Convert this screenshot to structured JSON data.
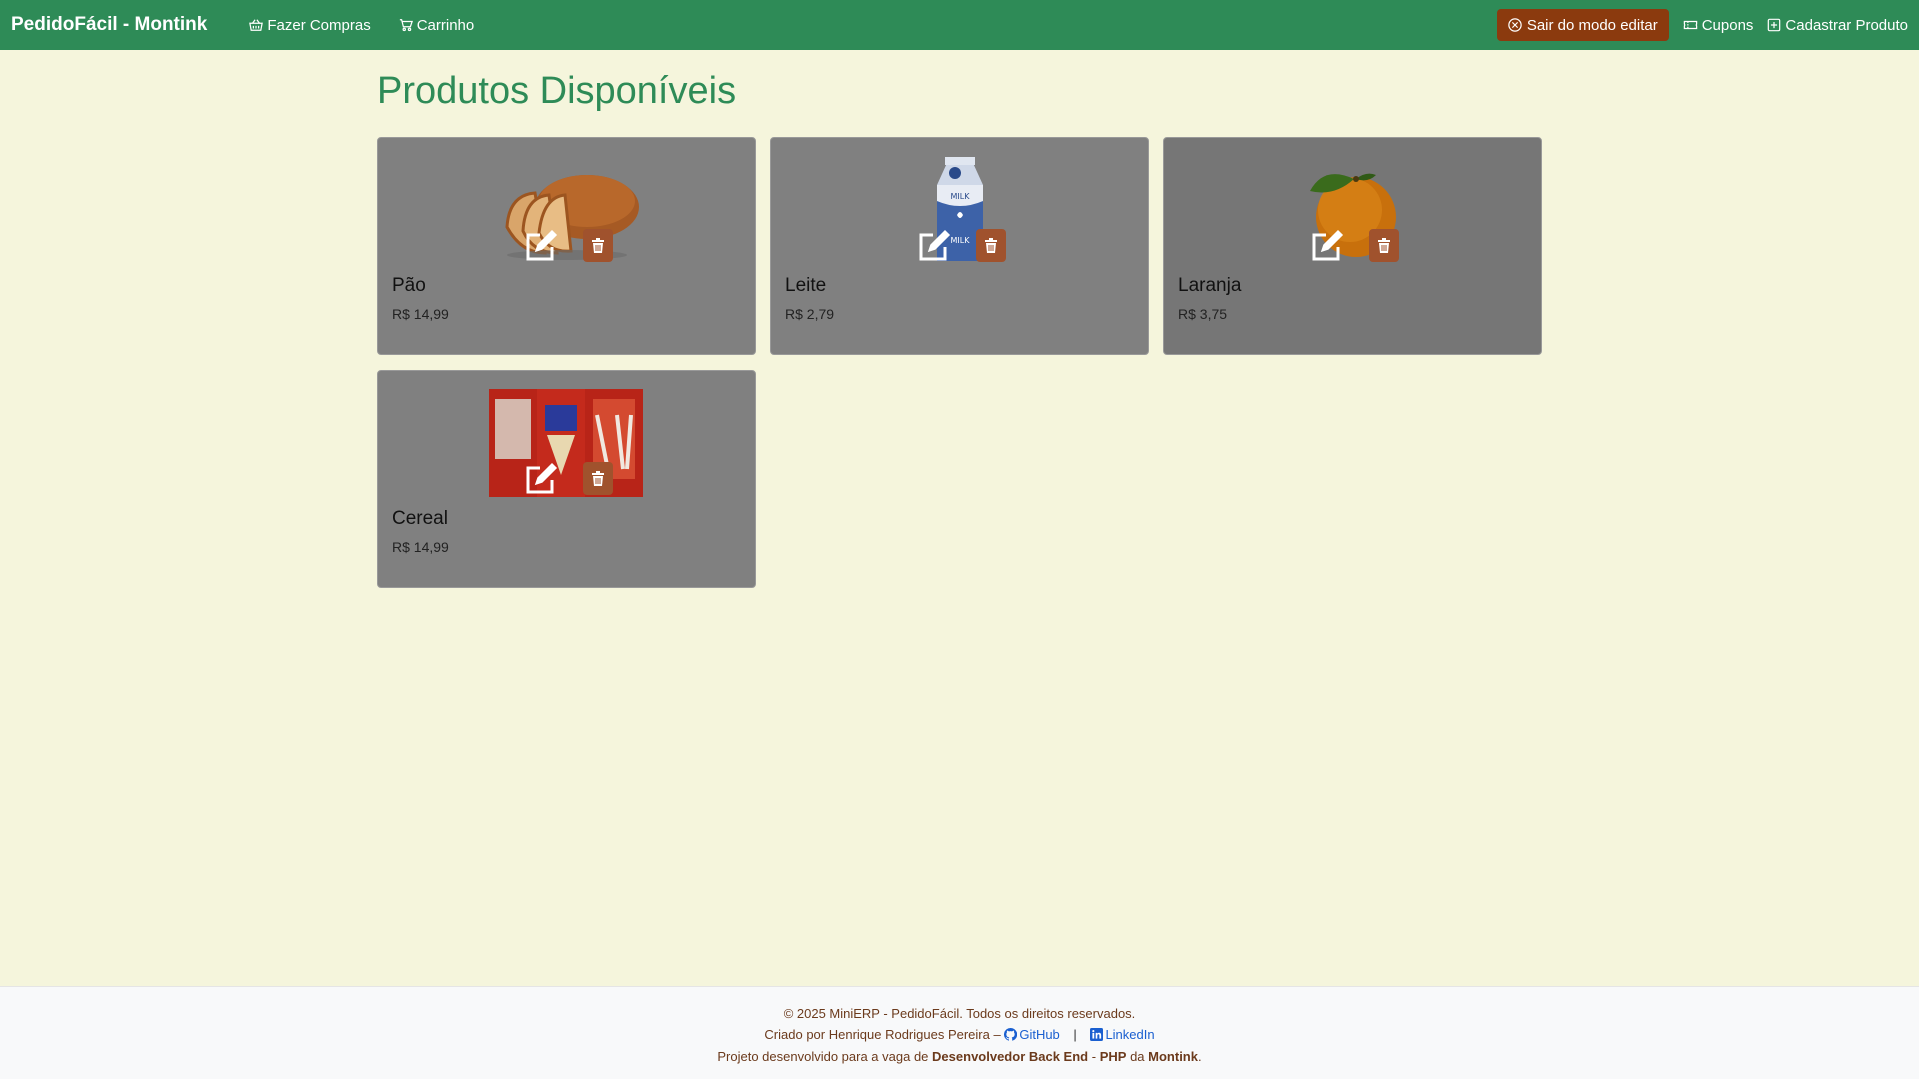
{
  "navbar": {
    "brand": "PedidoFácil - Montink",
    "shop_link": "Fazer Compras",
    "cart_link": "Carrinho",
    "exit_edit_button": "Sair do modo editar",
    "coupons_link": "Cupons",
    "register_product_link": "Cadastrar Produto",
    "bg_color": "#2e8b57",
    "exit_button_color": "#8b3a0e"
  },
  "page": {
    "title": "Produtos Disponíveis",
    "title_color": "#2e8b57",
    "background_color": "#f5f5dc"
  },
  "products": [
    {
      "name": "Pão",
      "price": "R$ 14,99",
      "image_icon": "bread-image"
    },
    {
      "name": "Leite",
      "price": "R$ 2,79",
      "image_icon": "milk-carton-image"
    },
    {
      "name": "Laranja",
      "price": "R$ 3,75",
      "image_icon": "orange-image"
    },
    {
      "name": "Cereal",
      "price": "R$ 14,99",
      "image_icon": "cereal-box-image"
    }
  ],
  "card_actions": {
    "edit_icon": "edit-icon",
    "delete_icon": "trash-icon",
    "delete_color": "#a0522d"
  },
  "footer": {
    "copyright": "© 2025 MiniERP - PedidoFácil. Todos os direitos reservados.",
    "created_by": "Criado por Henrique Rodrigues Pereira –",
    "github": "GitHub",
    "separator": "|",
    "linkedin": "LinkedIn",
    "project_prefix": "Projeto desenvolvido para a vaga de",
    "role": "Desenvolvedor Back End",
    "dash": "-",
    "tech": "PHP",
    "da": "da",
    "company": "Montink",
    "period": "."
  }
}
